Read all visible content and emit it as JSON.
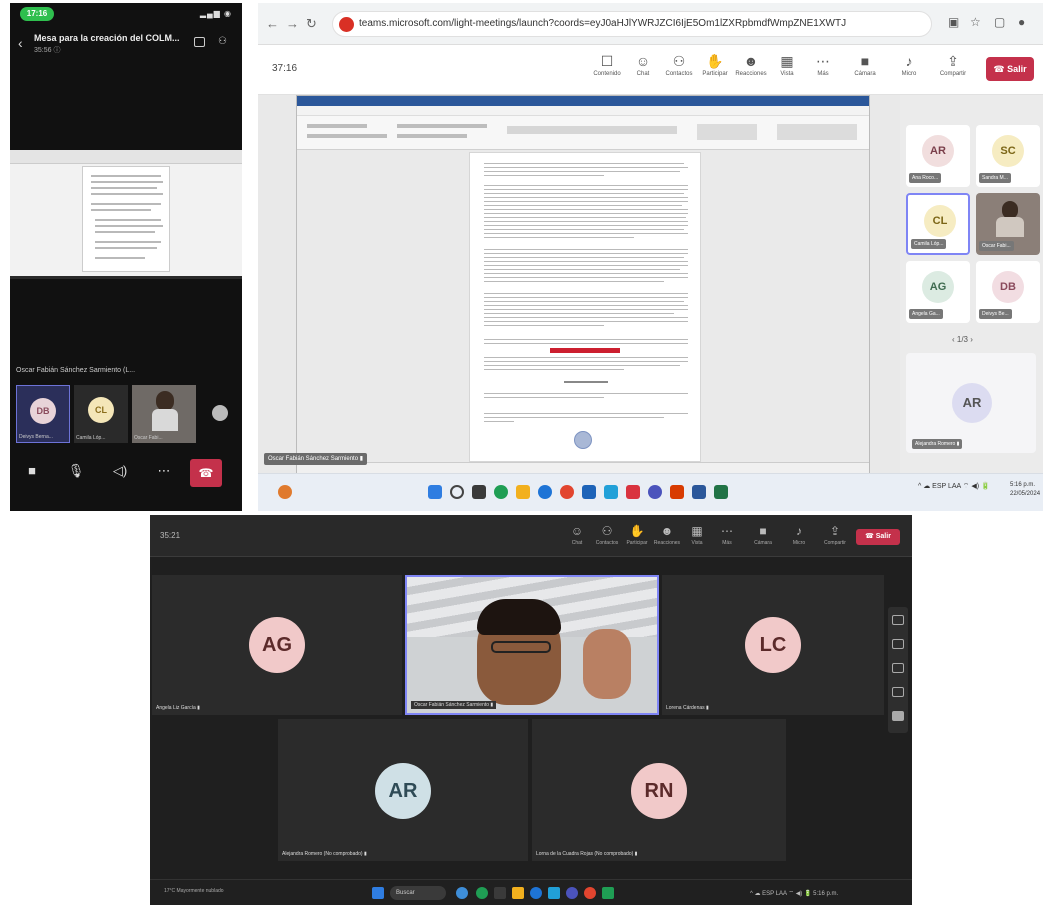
{
  "mobile": {
    "status_time": "17:16",
    "status_icons": "▂▄▆ ◉",
    "meeting_title": "Mesa para la creación del COLM...",
    "meeting_sub": "35:56 ⓘ",
    "presenter_label": "Oscar Fabián Sánchez Sarmiento (L...",
    "tiles": [
      {
        "initials": "DB",
        "name": "Deivys Berna...",
        "bg": "#e8d3d8",
        "fg": "#8a4a5c"
      },
      {
        "initials": "CL",
        "name": "Camila Lóp...",
        "bg": "#f4e6b8",
        "fg": "#8a6d1c"
      },
      {
        "initials": "",
        "name": "Oscar Fabi...",
        "bg": "#888888",
        "fg": "#ffffff"
      }
    ]
  },
  "browser": {
    "url": "teams.microsoft.com/light-meetings/launch?coords=eyJ0aHJlYWRJZCI6IjE5Om1lZXRpbmdfWmpZNE1XWTJ",
    "timer": "37:16",
    "toolbar": [
      {
        "icon": "☐",
        "label": "Contenido"
      },
      {
        "icon": "☺",
        "label": "Chat"
      },
      {
        "icon": "⚇",
        "label": "Contactos"
      },
      {
        "icon": "✋",
        "label": "Participar"
      },
      {
        "icon": "☻",
        "label": "Reacciones"
      },
      {
        "icon": "▦",
        "label": "Vista"
      },
      {
        "icon": "⋯",
        "label": "Más"
      },
      {
        "icon": "■",
        "label": "Cámara"
      },
      {
        "icon": "♪",
        "label": "Micro"
      },
      {
        "icon": "⇪",
        "label": "Compartir"
      }
    ],
    "leave_label": "☎ Salir",
    "presenter_label": "Oscar Fabián Sánchez Sarmiento ▮",
    "participants": [
      {
        "initials": "AR",
        "name": "Ana Roco...",
        "bg": "#f1dede",
        "fg": "#7a3e4a"
      },
      {
        "initials": "SC",
        "name": "Sandra M...",
        "bg": "#f6ecc2",
        "fg": "#7b6516"
      },
      {
        "initials": "CL",
        "name": "Camila Lóp...",
        "bg": "#f6ecc2",
        "fg": "#7b6516"
      },
      {
        "initials": "",
        "name": "Oscar Fabi...",
        "bg": "#8b7f78",
        "fg": "#ffffff"
      },
      {
        "initials": "AG",
        "name": "Angela Ga...",
        "bg": "#dcebe2",
        "fg": "#3f6b50"
      },
      {
        "initials": "DB",
        "name": "Deivys Be...",
        "bg": "#f2dde2",
        "fg": "#8a4a5c"
      }
    ],
    "pager": "‹   1/3   ›",
    "big_tile": {
      "initials": "AR",
      "name": "Alejandra Romero ▮"
    },
    "tray_text": "^  ☁  ESP LAA  ⌔ ◀) 🔋",
    "clock_line1": "5:16 p.m.",
    "clock_line2": "22/05/2024"
  },
  "desktop": {
    "timer": "35:21",
    "toolbar": [
      {
        "icon": "☺",
        "label": "Chat"
      },
      {
        "icon": "⚇",
        "label": "Contactos"
      },
      {
        "icon": "✋",
        "label": "Participar"
      },
      {
        "icon": "☻",
        "label": "Reacciones"
      },
      {
        "icon": "▦",
        "label": "Vista"
      },
      {
        "icon": "⋯",
        "label": "Más"
      },
      {
        "icon": "■",
        "label": "Cámara"
      },
      {
        "icon": "♪",
        "label": "Micro"
      },
      {
        "icon": "⇪",
        "label": "Compartir"
      }
    ],
    "leave_label": "☎ Salir",
    "tiles": [
      {
        "initials": "AG",
        "name": "Angela Liz García ▮",
        "bg": "#f1c9c9",
        "fg": "#5b2a2a"
      },
      {
        "initials": "LC",
        "name": "Lorena Cárdenas ▮",
        "bg": "#f1c9c9",
        "fg": "#5b2a2a"
      },
      {
        "initials": "AR",
        "name": "Alejandra Romero (No comprobado) ▮",
        "bg": "#cfe0e6",
        "fg": "#2f4b56"
      },
      {
        "initials": "RN",
        "name": "Lorna de la Cuadra Rojas (No comprobado) ▮",
        "bg": "#f1c9c9",
        "fg": "#5b2a2a"
      }
    ],
    "video_name": "Oscar Fabián Sánchez Sarmiento ▮",
    "weather": "17°C Mayormente nublado",
    "search": "Buscar",
    "tray_text": "^  ☁  ESP LAA  ⌔ ◀) 🔋  5:16 p.m."
  },
  "colors": {
    "teams_red": "#c4314b",
    "accent": "#7f85f5"
  }
}
